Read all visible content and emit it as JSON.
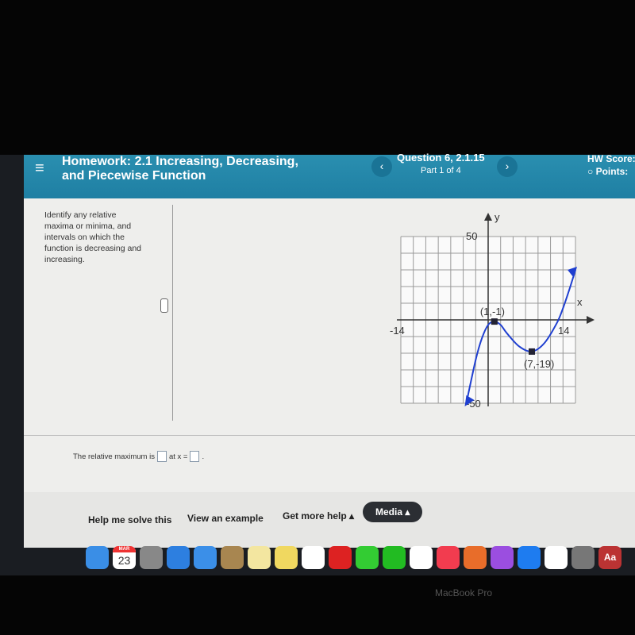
{
  "header": {
    "menu_icon": "hamburger-icon",
    "title_line1": "Homework: 2.1 Increasing, Decreasing,",
    "title_line2": "and Piecewise Function",
    "question": "Question 6, 2.1.15",
    "part": "Part 1 of 4",
    "hw_score": "HW Score:",
    "points": "Points:"
  },
  "instructions": "Identify any relative maxima or minima, and intervals on which the function is decreasing and increasing.",
  "answer": {
    "prefix": "The relative maximum is",
    "mid": "at x =",
    "suffix": ".",
    "value1": "",
    "value2": ""
  },
  "footer": {
    "help": "Help me solve this",
    "example": "View an example",
    "more": "Get more help ▴",
    "media": "Media ▴"
  },
  "dock": [
    "Finder",
    "23",
    "Launchpad",
    "Safari",
    "Mail",
    "Contacts",
    "Notes",
    "Stickies",
    "Photos",
    "Photo Booth",
    "Messages",
    "FaceTime",
    "Chrome",
    "Music",
    "Keynote",
    "Podcasts",
    "App Store",
    "News",
    "Calculator",
    "Aa"
  ],
  "dock_month": "MAR",
  "laptop": "MacBook Pro",
  "chart_data": {
    "type": "line",
    "xlabel": "x",
    "ylabel": "y",
    "xlim": [
      -14,
      14
    ],
    "ylim": [
      -50,
      50
    ],
    "grid": true,
    "xticks": [
      "-14",
      "14"
    ],
    "yticks": [
      "50",
      "-50"
    ],
    "color": "#1f3fd0",
    "points": [
      [
        -3.5,
        -50
      ],
      [
        -2,
        -24
      ],
      [
        -1,
        -11
      ],
      [
        0,
        -3
      ],
      [
        1,
        -1
      ],
      [
        2,
        -3
      ],
      [
        3,
        -8
      ],
      [
        5,
        -16
      ],
      [
        7,
        -19
      ],
      [
        9,
        -14
      ],
      [
        11,
        -2
      ],
      [
        12,
        7
      ],
      [
        13,
        18
      ],
      [
        14,
        30
      ]
    ],
    "labels": [
      {
        "text": "(1,-1)",
        "x": 1,
        "y": -1
      },
      {
        "text": "(7,-19)",
        "x": 7,
        "y": -19
      }
    ]
  }
}
